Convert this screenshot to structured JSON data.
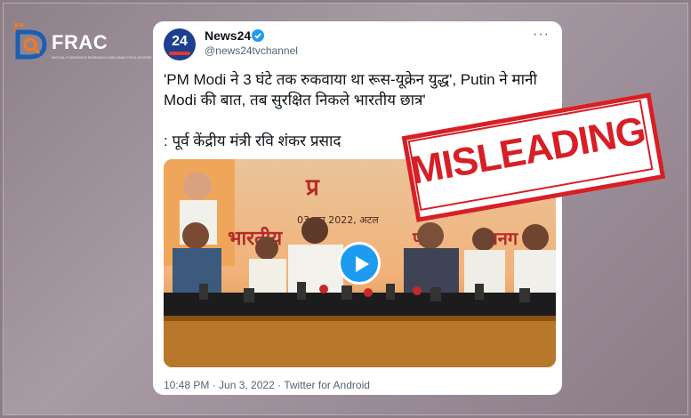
{
  "logo": {
    "text": "FRAC",
    "letter": "D",
    "tagline": "DIGITAL FORENSICS RESEARCH AND ANALYTICS CENTRE"
  },
  "tweet": {
    "author": "News24",
    "handle": "@news24tvchannel",
    "avatar_text": "24",
    "more_label": "···",
    "text": "'PM Modi ने 3 घंटे तक रुकवाया था रूस-यूक्रेन युद्ध', Putin ने मानी Modi की बात, तब सुरक्षित निकले भारतीय छात्र'",
    "quote_line": ": पूर्व केंद्रीय मंत्री रवि शंकर  प्रसाद",
    "media": {
      "banner_date": "03 जून 2022, अटल",
      "banner_line2": "भारतीय",
      "banner_line3": "पार्टी",
      "banner_line4": "हानग"
    },
    "timestamp": "10:48 PM · Jun 3, 2022 · Twitter for Android"
  },
  "stamp": {
    "label": "MISLEADING"
  },
  "colors": {
    "stamp_red": "#d71f26",
    "twitter_blue": "#1d9bf0",
    "logo_orange": "#f47b20"
  }
}
